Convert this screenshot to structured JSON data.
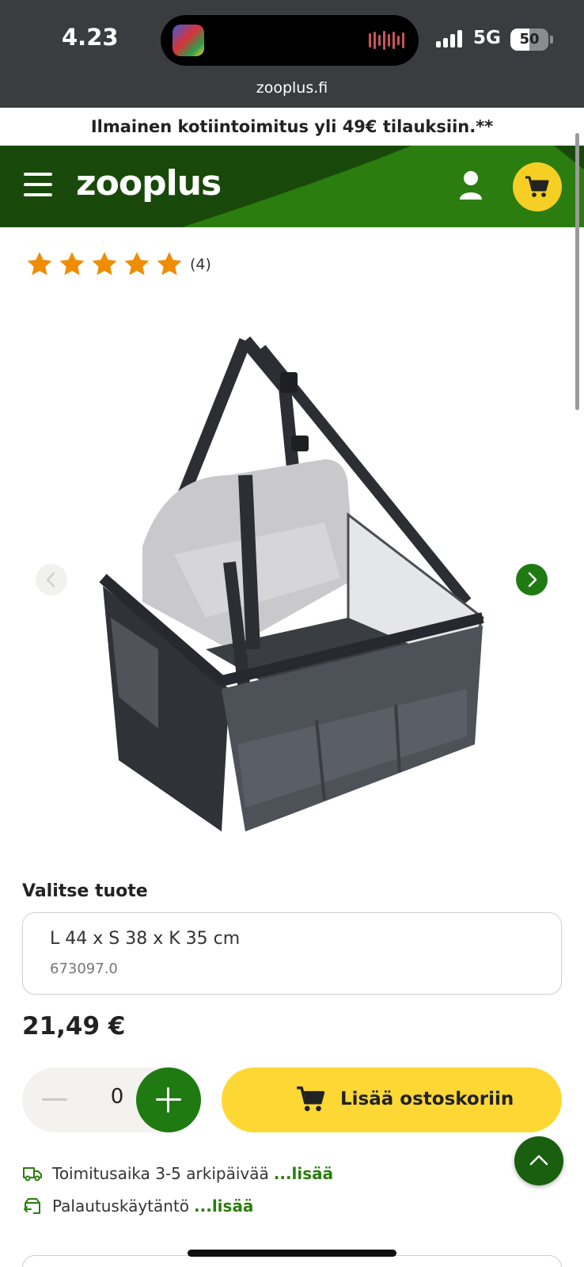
{
  "status_bar": {
    "time": "4.23",
    "network": "5G",
    "battery_percent": "50",
    "battery_level": 0.5,
    "url": "zooplus.fi"
  },
  "promo": {
    "text": "Ilmainen kotiintoimitus yli 49€ tilauksiin.**"
  },
  "header": {
    "logo": "zooplus",
    "menu_icon": "hamburger-menu-icon",
    "account_icon": "user-icon",
    "cart_icon": "shopping-cart-icon",
    "brand_color": "#2a7d0e",
    "accent_color": "#f5cf23"
  },
  "rating": {
    "stars": 5,
    "count": "(4)",
    "star_color": "#f08c00"
  },
  "gallery": {
    "prev_icon": "chevron-left-icon",
    "next_icon": "chevron-right-icon"
  },
  "variant": {
    "label": "Valitse tuote",
    "name": "L 44 x S 38 x K 35 cm",
    "sku": "673097.0"
  },
  "price": "21,49 €",
  "quantity": {
    "value": "0"
  },
  "add_to_cart": {
    "label": "Lisää ostoskoriin",
    "color": "#fdd835"
  },
  "info": {
    "delivery_text": "Toimitusaika 3-5 arkipäivää",
    "delivery_link": "...lisää",
    "returns_text": "Palautuskäytäntö",
    "returns_link": "...lisää"
  }
}
